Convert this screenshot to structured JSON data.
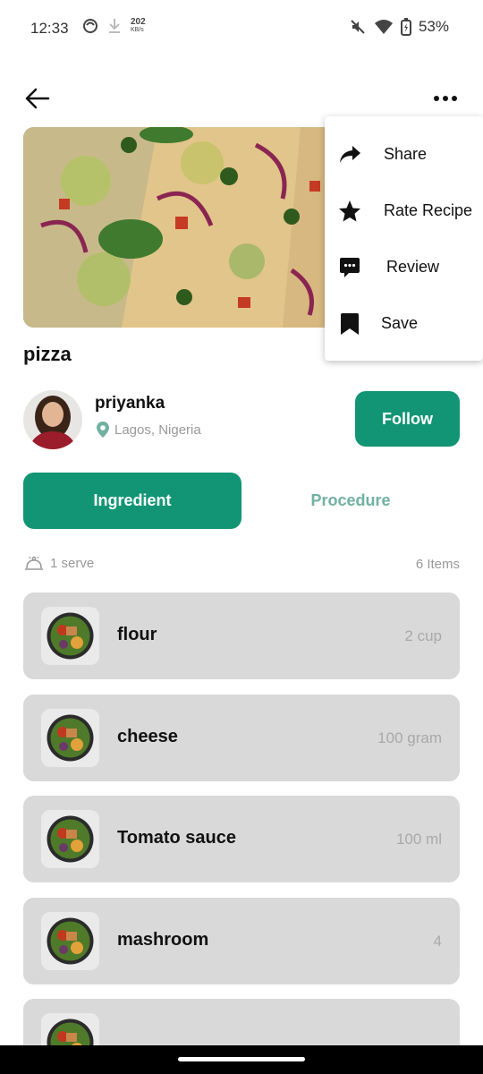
{
  "status_bar": {
    "time": "12:33",
    "net_speed": "202",
    "net_speed_unit": "KB/s",
    "battery": "53%"
  },
  "recipe": {
    "title": "pizza"
  },
  "author": {
    "name": "priyanka",
    "location": "Lagos, Nigeria",
    "follow_label": "Follow"
  },
  "tabs": {
    "ingredient": "Ingredient",
    "procedure": "Procedure"
  },
  "meta": {
    "serves": "1 serve",
    "items_count": "6 Items"
  },
  "ingredients": [
    {
      "name": "flour",
      "qty": "2 cup"
    },
    {
      "name": "cheese",
      "qty": "100 gram"
    },
    {
      "name": "Tomato sauce",
      "qty": "100 ml"
    },
    {
      "name": "mashroom",
      "qty": "4"
    },
    {
      "name": "",
      "qty": ""
    }
  ],
  "menu": {
    "share": "Share",
    "rate": "Rate Recipe",
    "review": "Review",
    "save": "Save"
  },
  "colors": {
    "accent": "#129575",
    "accent_light": "#71b1a1",
    "card": "#d9d9d9"
  }
}
